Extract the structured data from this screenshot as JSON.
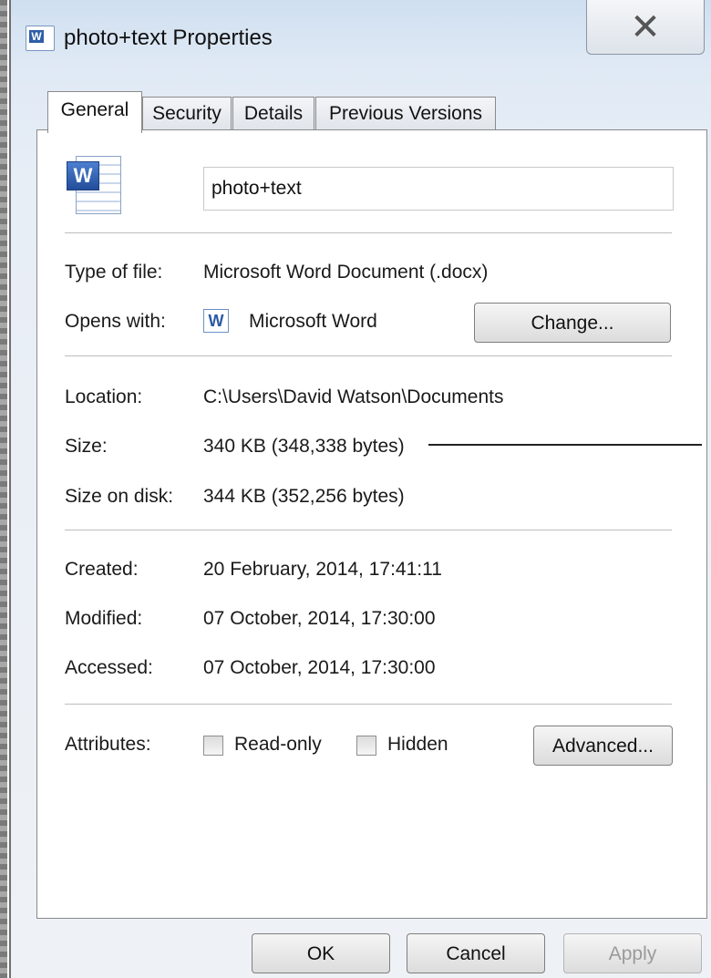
{
  "window": {
    "title": "photo+text Properties",
    "close_glyph": "✕"
  },
  "tabs": [
    {
      "label": "General",
      "active": true
    },
    {
      "label": "Security",
      "active": false
    },
    {
      "label": "Details",
      "active": false
    },
    {
      "label": "Previous Versions",
      "active": false
    }
  ],
  "file": {
    "icon": "word-document-icon",
    "icon_letter": "W",
    "name": "photo+text"
  },
  "type_section": {
    "type_label": "Type of file:",
    "type_value": "Microsoft Word Document (.docx)",
    "opens_label": "Opens with:",
    "opens_icon_letter": "W",
    "opens_value": "Microsoft Word",
    "change_button": "Change..."
  },
  "location_section": {
    "location_label": "Location:",
    "location_value": "C:\\Users\\David Watson\\Documents",
    "size_label": "Size:",
    "size_value": "340 KB (348,338 bytes)",
    "size_on_disk_label": "Size on disk:",
    "size_on_disk_value": "344 KB (352,256 bytes)"
  },
  "dates_section": {
    "created_label": "Created:",
    "created_value": "20 February, 2014, 17:41:11",
    "modified_label": "Modified:",
    "modified_value": "07 October, 2014, 17:30:00",
    "accessed_label": "Accessed:",
    "accessed_value": "07 October, 2014, 17:30:00"
  },
  "attributes": {
    "label": "Attributes:",
    "read_only_label": "Read-only",
    "read_only_checked": false,
    "hidden_label": "Hidden",
    "hidden_checked": false,
    "advanced_button": "Advanced..."
  },
  "footer": {
    "ok": "OK",
    "cancel": "Cancel",
    "apply": "Apply",
    "apply_enabled": false
  },
  "colors": {
    "title_gradient_top": "#cfdff0",
    "word_blue": "#2f5da8",
    "disabled_text": "#9a9a9a"
  }
}
